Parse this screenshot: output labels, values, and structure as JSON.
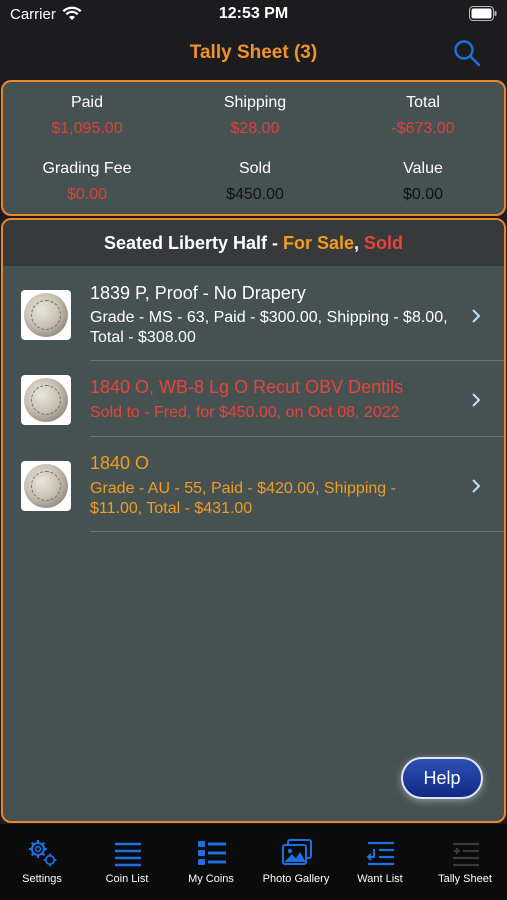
{
  "status": {
    "carrier": "Carrier",
    "time": "12:53 PM"
  },
  "nav": {
    "title": "Tally Sheet (3)"
  },
  "summary": {
    "paid_label": "Paid",
    "paid_value": "$1,095.00",
    "shipping_label": "Shipping",
    "shipping_value": "$28.00",
    "total_label": "Total",
    "total_value": "-$673.00",
    "grading_label": "Grading Fee",
    "grading_value": "$0.00",
    "sold_label": "Sold",
    "sold_value": "$450.00",
    "value_label": "Value",
    "value_value": "$0.00"
  },
  "list": {
    "header_prefix": "Seated Liberty Half - ",
    "header_for_sale": "For Sale",
    "header_comma": ", ",
    "header_sold": "Sold",
    "items": [
      {
        "title": "1839 P, Proof - No Drapery",
        "sub": "Grade - MS - 63, Paid - $300.00, Shipping - $8.00, Total - $308.00",
        "color": "#ffffff"
      },
      {
        "title": "1840 O, WB-8 Lg O Recut OBV Dentils",
        "sub": "Sold to - Fred, for $450.00, on Oct 08, 2022",
        "color": "#e8443a"
      },
      {
        "title": "1840 O",
        "sub": "Grade - AU - 55, Paid - $420.00, Shipping - $11.00, Total - $431.00",
        "color": "#f39c1f"
      }
    ]
  },
  "help": {
    "label": "Help"
  },
  "tabs": [
    {
      "label": "Settings",
      "icon": "gears-icon"
    },
    {
      "label": "Coin List",
      "icon": "list-icon"
    },
    {
      "label": "My Coins",
      "icon": "grid-list-icon"
    },
    {
      "label": "Photo Gallery",
      "icon": "photos-icon"
    },
    {
      "label": "Want List",
      "icon": "want-list-icon"
    },
    {
      "label": "Tally Sheet",
      "icon": "tally-icon"
    }
  ],
  "colors": {
    "accent": "#f0922e",
    "panel": "#465152",
    "blue": "#1e6fe0",
    "red": "#e0403c"
  }
}
